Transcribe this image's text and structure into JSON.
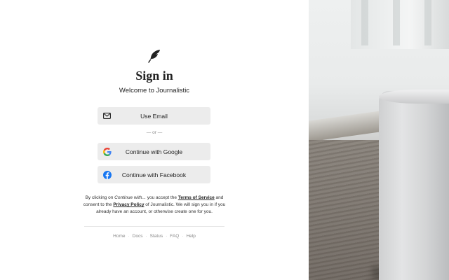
{
  "header": {
    "title": "Sign in",
    "subtitle": "Welcome to Journalistic"
  },
  "buttons": {
    "email": {
      "label": "Use Email",
      "icon": "mail-icon"
    },
    "google": {
      "label": "Continue with Google",
      "icon": "google-icon"
    },
    "facebook": {
      "label": "Continue with Facebook",
      "icon": "facebook-icon"
    }
  },
  "divider": "— or —",
  "legal": {
    "part1": "By clicking on ",
    "continue_with": "Continue with...",
    "part2": " you accept the ",
    "terms_link": "Terms of Service",
    "part3": " and consent to the ",
    "privacy_link": "Privacy Policy",
    "part4": " of Journalistic. We will sign you in if you already have an account, or otherwise create one for you."
  },
  "footer": {
    "links": [
      "Home",
      "Docs",
      "Status",
      "FAQ",
      "Help"
    ],
    "separator": "·"
  },
  "colors": {
    "button_bg": "#ececec",
    "google_blue": "#4285F4",
    "google_red": "#EA4335",
    "google_yellow": "#FBBC05",
    "google_green": "#34A853",
    "facebook_blue": "#1877F2"
  }
}
